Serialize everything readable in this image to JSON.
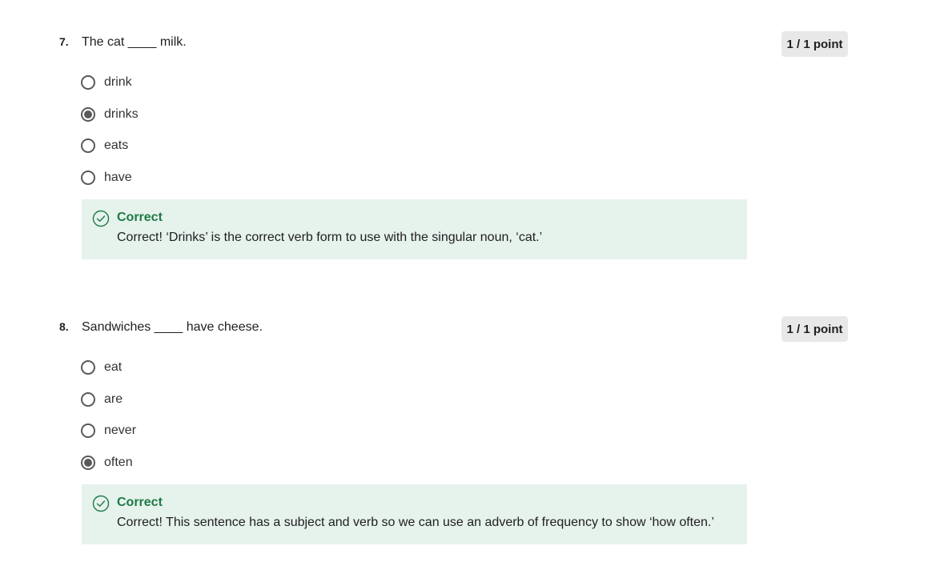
{
  "questions": [
    {
      "number": "7.",
      "text": "The cat ____ milk.",
      "points": "1 / 1 point",
      "options": [
        {
          "label": "drink",
          "selected": false
        },
        {
          "label": "drinks",
          "selected": true
        },
        {
          "label": "eats",
          "selected": false
        },
        {
          "label": "have",
          "selected": false
        }
      ],
      "feedback": {
        "status": "Correct",
        "message": "Correct!   ‘Drinks’ is the correct verb form to use with the singular noun, ‘cat.’"
      }
    },
    {
      "number": "8.",
      "text": "Sandwiches ____ have cheese.",
      "points": "1 / 1 point",
      "options": [
        {
          "label": "eat",
          "selected": false
        },
        {
          "label": "are",
          "selected": false
        },
        {
          "label": "never",
          "selected": false
        },
        {
          "label": "often",
          "selected": true
        }
      ],
      "feedback": {
        "status": "Correct",
        "message": "Correct! This sentence has a subject and verb so we can use an adverb of frequency to show ‘how often.’"
      }
    }
  ],
  "icons": {
    "feedback_icon": "check-circle-icon",
    "radio_icon": "radio-button"
  },
  "colors": {
    "correct_green": "#1e7a45",
    "feedback_bg": "#e6f2ec",
    "points_bg": "#e8e8e8"
  }
}
